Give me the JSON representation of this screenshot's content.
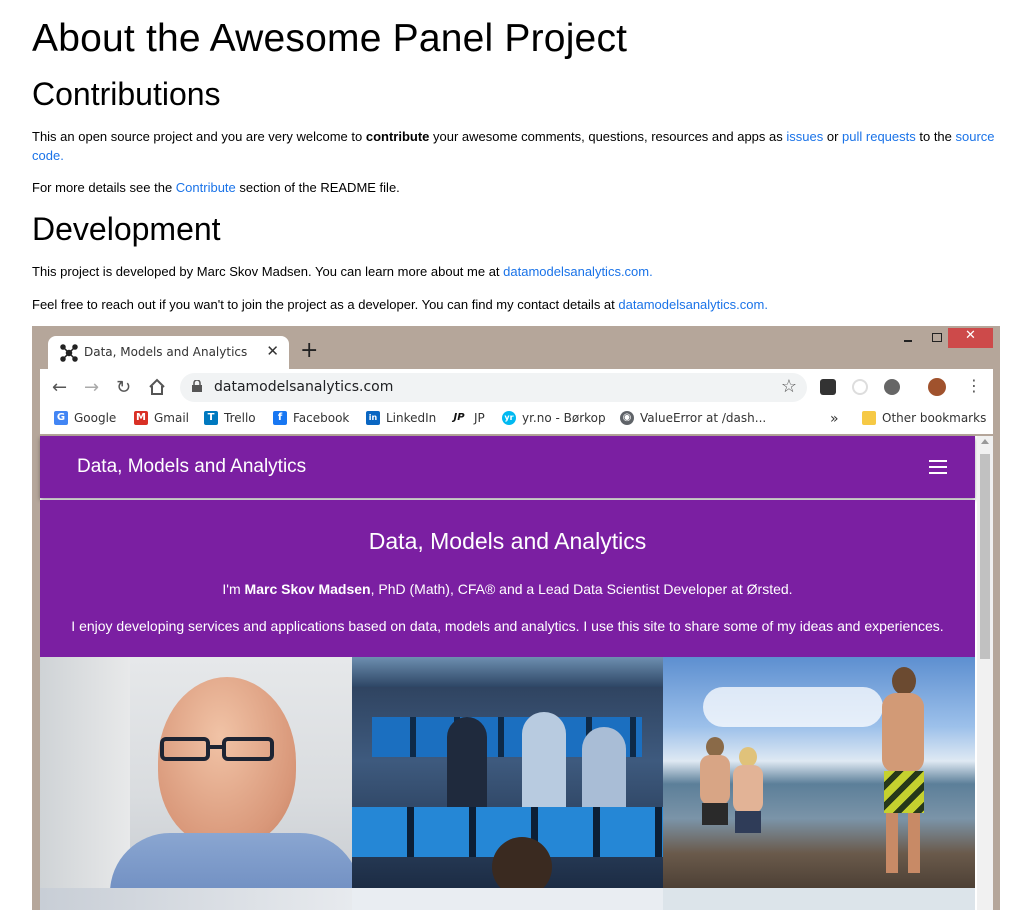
{
  "page": {
    "title": "About the Awesome Panel Project",
    "contributions": {
      "heading": "Contributions",
      "p1_a": "This an open source project and you are very welcome to ",
      "p1_b": "contribute",
      "p1_c": " your awesome comments, questions, resources and apps as ",
      "p1_issues": "issues",
      "p1_d": " or ",
      "p1_pr": "pull requests",
      "p1_e": " to the ",
      "p1_source": "source",
      "p1_code": "code",
      "p1_end": ".",
      "p2_a": "For more details see the ",
      "p2_link": "Contribute",
      "p2_b": " section of the README file."
    },
    "development": {
      "heading": "Development",
      "p1_a": "This project is developed by Marc Skov Madsen. You can learn more about me at ",
      "p1_link": "datamodelsanalytics.com",
      "p1_end": ".",
      "p2_a": "Feel free to reach out if you wan't to join the project as a developer. You can find my contact details at ",
      "p2_link": "datamodelsanalytics.com",
      "p2_end": "."
    }
  },
  "screenshot": {
    "tab_title": "Data, Models and Analytics",
    "tab_close": "✕",
    "new_tab": "+",
    "url": "datamodelsanalytics.com",
    "bookmarks": [
      {
        "label": "Google",
        "icon": "google-icon",
        "color": "#4285f4",
        "glyph": "G"
      },
      {
        "label": "Gmail",
        "icon": "gmail-icon",
        "color": "#d93025",
        "glyph": "M"
      },
      {
        "label": "Trello",
        "icon": "trello-icon",
        "color": "#0079bf",
        "glyph": "T"
      },
      {
        "label": "Facebook",
        "icon": "facebook-icon",
        "color": "#1877f2",
        "glyph": "f"
      },
      {
        "label": "LinkedIn",
        "icon": "linkedin-icon",
        "color": "#0a66c2",
        "glyph": "in"
      },
      {
        "label": "JP",
        "icon": "jp-icon",
        "color": "#111111",
        "glyph": "JP"
      },
      {
        "label": "yr.no - Børkop",
        "icon": "yr-icon",
        "color": "#00b9f1",
        "glyph": "yr"
      },
      {
        "label": "ValueError at /dash...",
        "icon": "globe-icon",
        "color": "#5f6368",
        "glyph": "◉"
      }
    ],
    "bookmarks_overflow": "»",
    "other_bookmarks": "Other bookmarks",
    "site": {
      "brand": "Data, Models and Analytics",
      "hero_title": "Data, Models and Analytics",
      "hero_line1_a": "I'm ",
      "hero_line1_name": "Marc Skov Madsen",
      "hero_line1_b": ", PhD (Math), CFA® and a Lead Data Scientist Developer at Ørsted.",
      "hero_line2": "I enjoy developing services and applications based on data, models and analytics. I use this site to share some of my ideas and experiences.",
      "purple": "#7b1fa2"
    }
  },
  "colors": {
    "link": "#1a73e8",
    "window_frame": "#b5a69a",
    "close_button": "#cd4a4a"
  }
}
